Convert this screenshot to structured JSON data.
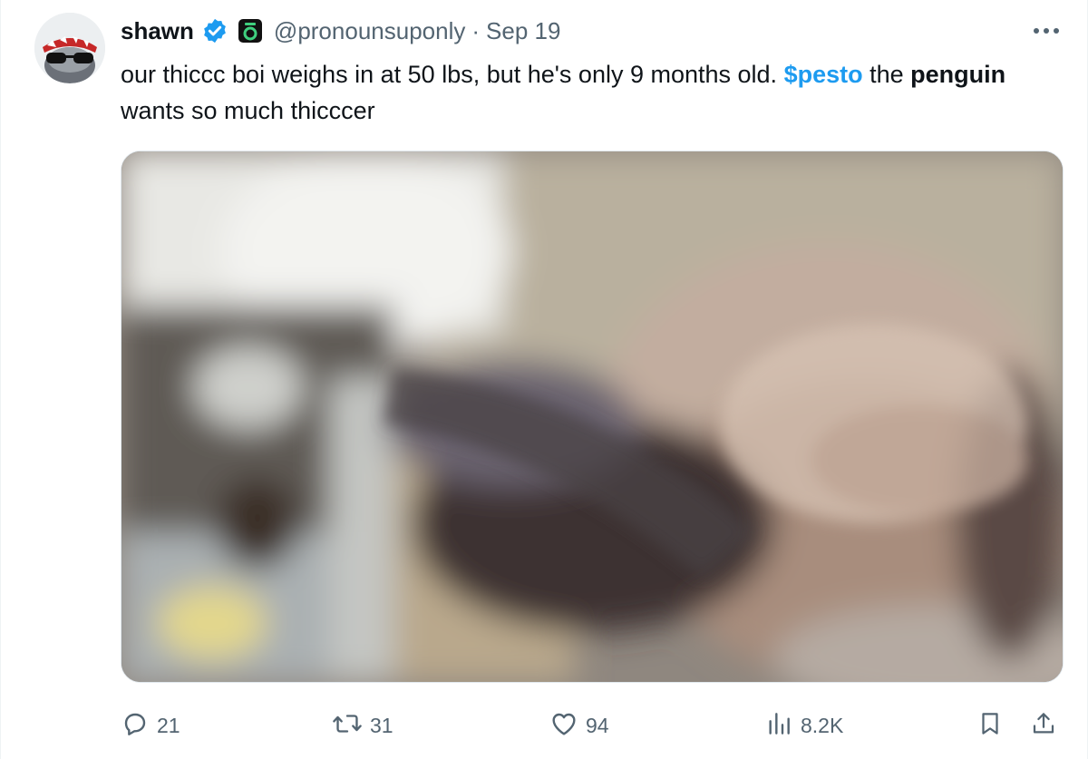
{
  "author": {
    "name": "shawn",
    "handle": "@pronounsuponly",
    "separator": "·",
    "date": "Sep 19",
    "verified": true
  },
  "tweet": {
    "text_part1": "our thiccc boi weighs in at 50 lbs, but he's only 9 months old. ",
    "cashtag": "$pesto",
    "text_part2": " the ",
    "bold_word": "penguin",
    "text_part3": " wants so much thicccer"
  },
  "media": {
    "type": "video-thumbnail"
  },
  "actions": {
    "replies": "21",
    "reposts": "31",
    "likes": "94",
    "views": "8.2K"
  },
  "colors": {
    "accent": "#1d9bf0",
    "muted": "#536471",
    "text": "#0f1419",
    "affiliate_badge": "#3fd07f"
  },
  "icons": [
    "more-icon",
    "verified-icon",
    "affiliate-badge-icon",
    "reply-icon",
    "repost-icon",
    "like-icon",
    "views-icon",
    "bookmark-icon",
    "share-icon"
  ]
}
